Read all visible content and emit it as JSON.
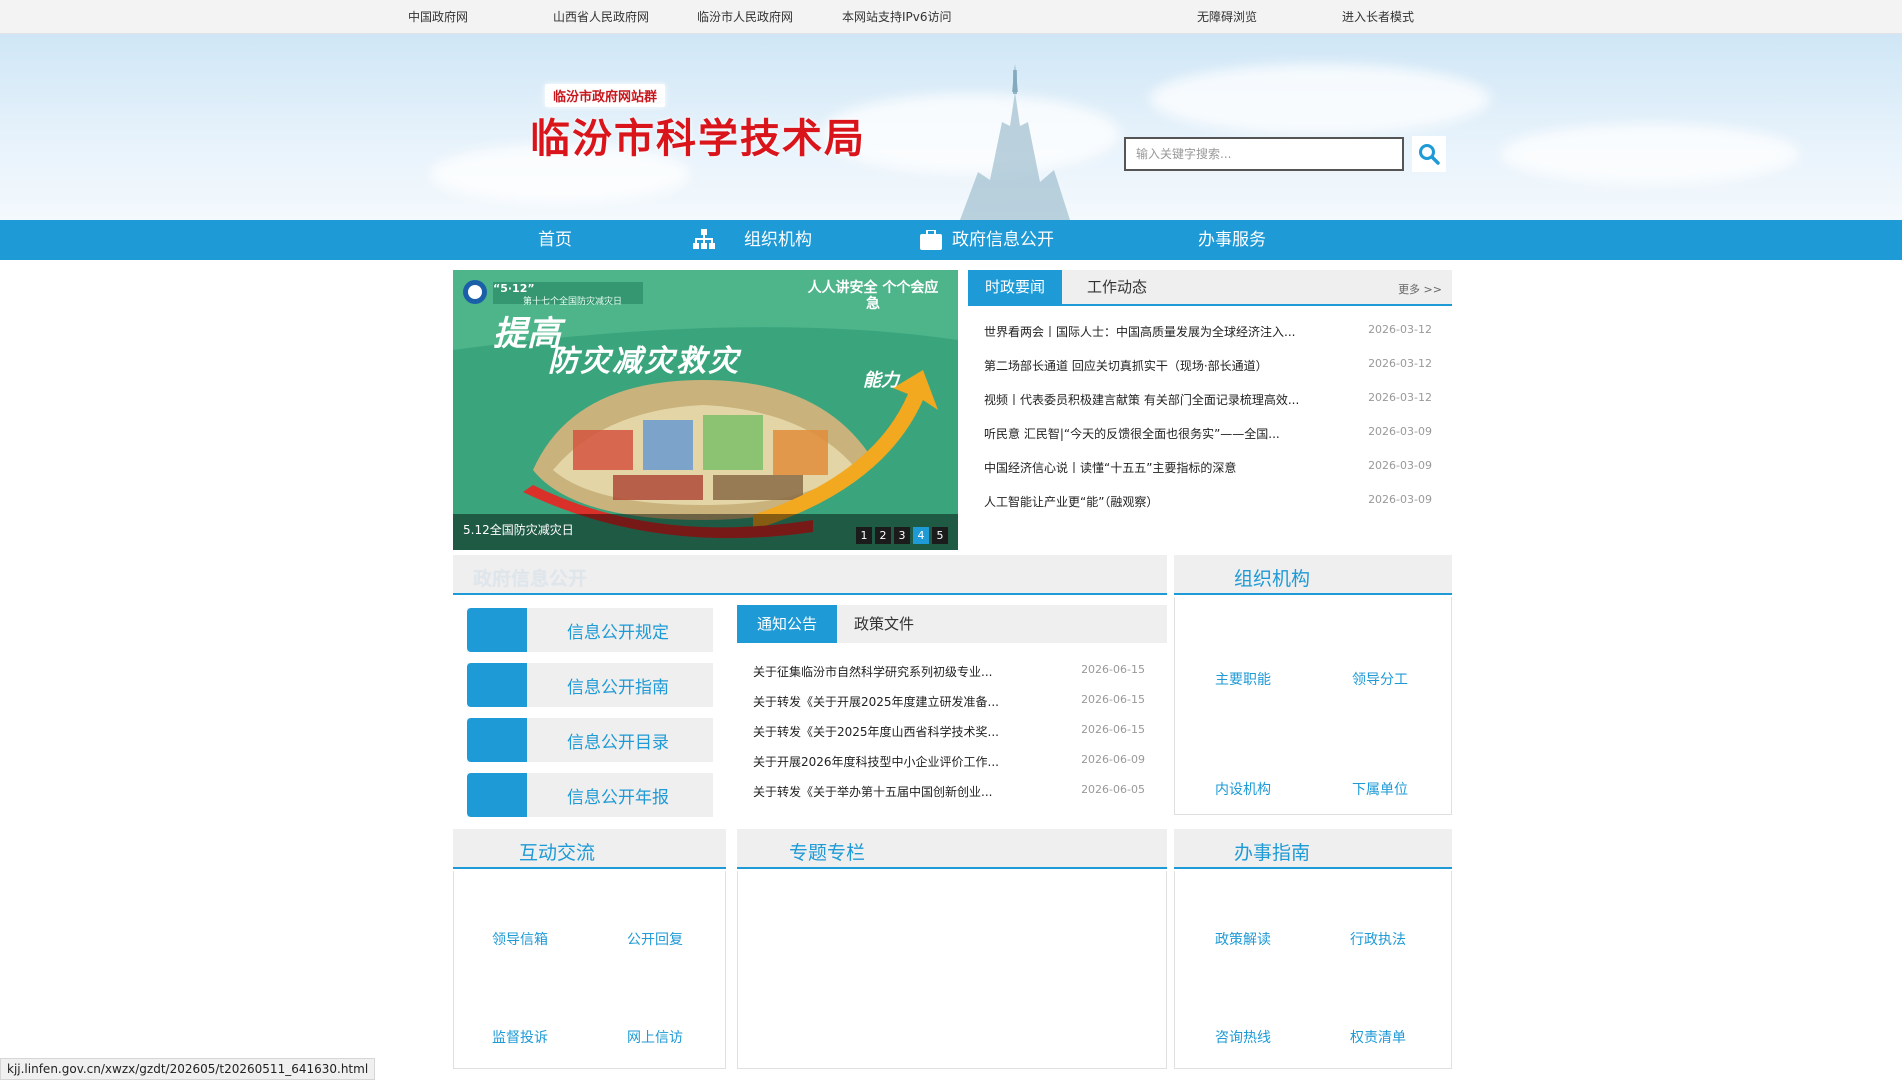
{
  "topbar": {
    "links": [
      "中国政府网",
      "山西省人民政府网",
      "临汾市人民政府网",
      "本网站支持IPv6访问",
      "无障碍浏览",
      "进入长者模式"
    ]
  },
  "header": {
    "site_group": "临汾市政府网站群",
    "title": "临汾市科学技术局",
    "search_placeholder": "输入关键字搜索..."
  },
  "nav": {
    "items": [
      "首页",
      "组织机构",
      "政府信息公开",
      "办事服务"
    ]
  },
  "slider": {
    "caption": "5.12全国防灾减灾日",
    "dots": [
      "1",
      "2",
      "3",
      "4",
      "5"
    ],
    "active_dot": "4",
    "poster_top_left": "“5·12”",
    "poster_top_left_sub": "第十七个全国防灾减灾日",
    "poster_top_right": "人人讲安全 个个会应急",
    "poster_line1": "提高",
    "poster_line2": "防灾减灾救灾",
    "poster_line3": "能力"
  },
  "news": {
    "tabs": [
      "时政要闻",
      "工作动态"
    ],
    "more": "更多 >>",
    "items": [
      {
        "title": "世界看两会丨国际人士：中国高质量发展为全球经济注入...",
        "date": "2026-03-12"
      },
      {
        "title": "第二场部长通道 回应关切真抓实干（现场·部长通道）",
        "date": "2026-03-12"
      },
      {
        "title": "视频丨代表委员积极建言献策 有关部门全面记录梳理高效...",
        "date": "2026-03-12"
      },
      {
        "title": "听民意 汇民智|“今天的反馈很全面也很务实”——全国...",
        "date": "2026-03-09"
      },
      {
        "title": "中国经济信心说丨读懂“十五五”主要指标的深意",
        "date": "2026-03-09"
      },
      {
        "title": "人工智能让产业更“能”（融观察）",
        "date": "2026-03-09"
      }
    ]
  },
  "gov_info": {
    "title": "政府信息公开",
    "buttons": [
      "信息公开规定",
      "信息公开指南",
      "信息公开目录",
      "信息公开年报"
    ],
    "tabs": [
      "通知公告",
      "政策文件"
    ],
    "items": [
      {
        "title": "关于征集临汾市自然科学研究系列初级专业...",
        "date": "2026-06-15"
      },
      {
        "title": "关于转发《关于开展2025年度建立研发准备...",
        "date": "2026-06-15"
      },
      {
        "title": "关于转发《关于2025年度山西省科学技术奖...",
        "date": "2026-06-15"
      },
      {
        "title": "关于开展2026年度科技型中小企业评价工作...",
        "date": "2026-06-09"
      },
      {
        "title": "关于转发《关于举办第十五届中国创新创业...",
        "date": "2026-06-05"
      }
    ]
  },
  "org": {
    "title": "组织机构",
    "links": [
      "主要职能",
      "领导分工",
      "内设机构",
      "下属单位"
    ]
  },
  "interaction": {
    "title": "互动交流",
    "links": [
      "领导信箱",
      "公开回复",
      "监督投诉",
      "网上信访"
    ]
  },
  "special": {
    "title": "专题专栏"
  },
  "guide": {
    "title": "办事指南",
    "links": [
      "政策解读",
      "行政执法",
      "咨询热线",
      "权责清单"
    ]
  },
  "status_url": "kjj.linfen.gov.cn/xwzx/gzdt/202605/t20260511_641630.html",
  "colors": {
    "primary": "#1e9ad6",
    "title_red": "#d9141b",
    "panel_gray": "#efefef"
  }
}
